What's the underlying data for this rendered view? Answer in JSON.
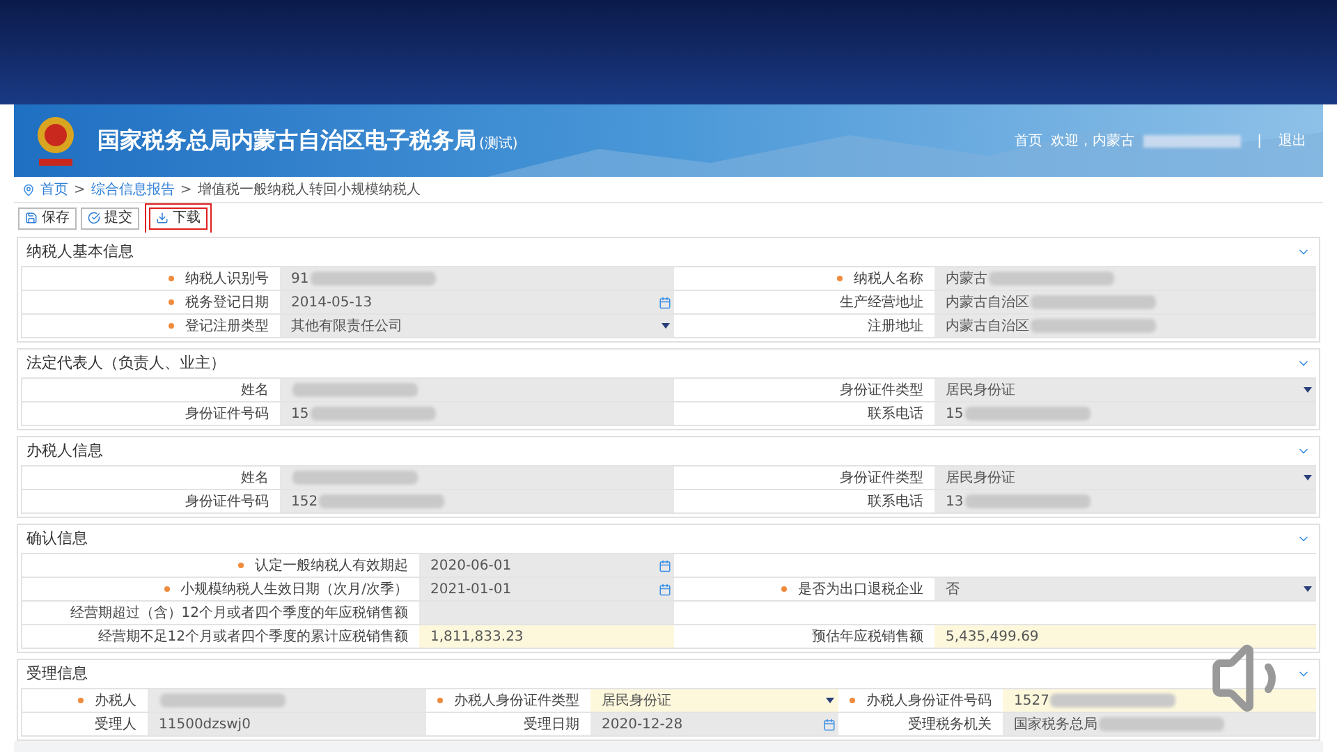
{
  "header": {
    "title": "国家税务总局内蒙古自治区电子税务局",
    "subtitle": "(测试)",
    "links": [
      {
        "label": "首页"
      },
      {
        "label": "欢迎，内蒙古",
        "redacted": true
      },
      {
        "label": "退出"
      }
    ],
    "separator": "|"
  },
  "breadcrumb": [
    {
      "label": "首页",
      "kind": "home"
    },
    {
      "label": "综合信息报告",
      "kind": "link"
    },
    {
      "label": "增值税一般纳税人转回小规模纳税人",
      "kind": "current"
    }
  ],
  "breadcrumb_separator": ">",
  "toolbar": [
    {
      "label": "保存",
      "kind": "save",
      "highlighted": false
    },
    {
      "label": "提交",
      "kind": "submit",
      "highlighted": false
    },
    {
      "label": "下载",
      "kind": "download",
      "highlighted": true
    }
  ],
  "sections": [
    {
      "title": "纳税人基本信息",
      "kind": "pairs",
      "rows": [
        [
          {
            "label": "纳税人识别号",
            "required": true,
            "value": "91",
            "redacted": true,
            "kind": "text",
            "highlighted": false
          },
          {
            "label": "纳税人名称",
            "required": true,
            "value": "内蒙古",
            "redacted": true,
            "kind": "text",
            "highlighted": false
          }
        ],
        [
          {
            "label": "税务登记日期",
            "required": true,
            "value": "2014-05-13",
            "redacted": false,
            "kind": "date",
            "highlighted": false
          },
          {
            "label": "生产经营地址",
            "required": false,
            "value": "内蒙古自治区",
            "redacted": true,
            "kind": "text",
            "highlighted": false
          }
        ],
        [
          {
            "label": "登记注册类型",
            "required": true,
            "value": "其他有限责任公司",
            "redacted": false,
            "kind": "select",
            "highlighted": false
          },
          {
            "label": "注册地址",
            "required": false,
            "value": "内蒙古自治区",
            "redacted": true,
            "kind": "text",
            "highlighted": false
          }
        ]
      ]
    },
    {
      "title": "法定代表人（负责人、业主）",
      "kind": "pairs",
      "rows": [
        [
          {
            "label": "姓名",
            "required": false,
            "redacted": true,
            "kind": "text",
            "highlighted": false
          },
          {
            "label": "身份证件类型",
            "required": false,
            "value": "居民身份证",
            "redacted": false,
            "kind": "select",
            "highlighted": false
          }
        ],
        [
          {
            "label": "身份证件号码",
            "required": false,
            "value": "15",
            "redacted": true,
            "kind": "text",
            "highlighted": false
          },
          {
            "label": "联系电话",
            "required": false,
            "value": "15",
            "redacted": true,
            "kind": "text",
            "highlighted": false
          }
        ]
      ]
    },
    {
      "title": "办税人信息",
      "kind": "pairs",
      "rows": [
        [
          {
            "label": "姓名",
            "required": false,
            "redacted": true,
            "kind": "text",
            "highlighted": false
          },
          {
            "label": "身份证件类型",
            "required": false,
            "value": "居民身份证",
            "redacted": false,
            "kind": "select",
            "highlighted": false
          }
        ],
        [
          {
            "label": "身份证件号码",
            "required": false,
            "value": "152",
            "redacted": true,
            "kind": "text",
            "highlighted": false
          },
          {
            "label": "联系电话",
            "required": false,
            "value": "13",
            "redacted": true,
            "kind": "text",
            "highlighted": false
          }
        ]
      ]
    },
    {
      "title": "确认信息",
      "kind": "confirm",
      "rows": [
        [
          {
            "label": "认定一般纳税人有效期起",
            "required": true,
            "value": "2020-06-01",
            "redacted": false,
            "kind": "date",
            "highlighted": false
          }
        ],
        [
          {
            "label": "小规模纳税人生效日期（次月/次季）",
            "required": true,
            "value": "2021-01-01",
            "redacted": false,
            "kind": "date",
            "highlighted": false
          },
          {
            "label": "是否为出口退税企业",
            "required": true,
            "value": "否",
            "redacted": false,
            "kind": "select",
            "highlighted": false
          }
        ],
        [
          {
            "label": "经营期超过（含）12个月或者四个季度的年应税销售额",
            "required": false,
            "redacted": false,
            "kind": "text",
            "highlighted": false
          }
        ],
        [
          {
            "label": "经营期不足12个月或者四个季度的累计应税销售额",
            "required": false,
            "value": "1,811,833.23",
            "redacted": false,
            "kind": "text",
            "highlighted": true
          },
          {
            "label": "预估年应税销售额",
            "required": false,
            "value": "5,435,499.69",
            "redacted": false,
            "kind": "text",
            "highlighted": true
          }
        ]
      ]
    },
    {
      "title": "受理信息",
      "kind": "triple",
      "rows": [
        [
          {
            "label": "办税人",
            "required": true,
            "redacted": true,
            "kind": "text",
            "highlighted": false
          },
          {
            "label": "办税人身份证件类型",
            "required": true,
            "value": "居民身份证",
            "redacted": false,
            "kind": "select",
            "highlighted": true
          },
          {
            "label": "办税人身份证件号码",
            "required": true,
            "value": "1527",
            "redacted": true,
            "kind": "text",
            "highlighted": true
          }
        ],
        [
          {
            "label": "受理人",
            "required": false,
            "value": "11500dzswj0",
            "redacted": false,
            "kind": "text",
            "highlighted": false
          },
          {
            "label": "受理日期",
            "required": false,
            "value": "2020-12-28",
            "redacted": false,
            "kind": "date",
            "highlighted": false
          },
          {
            "label": "受理税务机关",
            "required": false,
            "value": "国家税务总局",
            "redacted": true,
            "kind": "text",
            "highlighted": false
          }
        ]
      ]
    }
  ]
}
